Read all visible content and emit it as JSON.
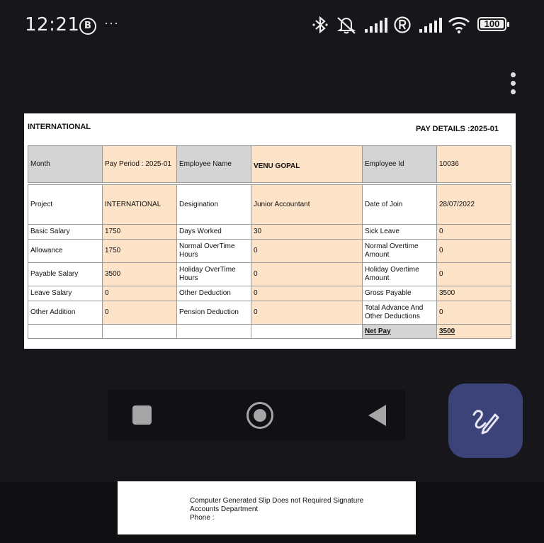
{
  "status": {
    "time": "12:21",
    "whatsapp_glyph": "B",
    "overflow": "···",
    "battery": "100"
  },
  "document": {
    "org": "INTERNATIONAL",
    "pay_details": "PAY DETAILS :2025-01",
    "header": {
      "month_label": "Month",
      "pay_period": "Pay Period : 2025-01",
      "employee_name_label": "Employee Name",
      "employee_name": "VENU GOPAL",
      "employee_id_label": "Employee Id",
      "employee_id": "10036"
    },
    "rows": [
      [
        "Project",
        "INTERNATIONAL",
        "Desigination",
        "Junior Accountant",
        "Date of Join",
        "28/07/2022"
      ],
      [
        "Basic Salary",
        "1750",
        "Days Worked",
        "30",
        "Sick Leave",
        "0"
      ],
      [
        "Allowance",
        "1750",
        "Normal OverTime Hours",
        "0",
        "Normal Overtime Amount",
        "0"
      ],
      [
        "Payable Salary",
        "3500",
        "Holiday OverTime Hours",
        "0",
        "Holiday Overtime Amount",
        "0"
      ],
      [
        "Leave Salary",
        "0",
        "Other Deduction",
        "0",
        "Gross Payable",
        "3500"
      ],
      [
        "Other Addition",
        "0",
        "Pension Deduction",
        "0",
        "Total Advance And Other Deductions",
        "0"
      ],
      [
        "",
        "",
        "",
        "",
        "Net Pay",
        "3500"
      ]
    ]
  },
  "footer": {
    "line1": "Computer Generated Slip Does not Required Signature",
    "line2": "Accounts Department",
    "line3": "Phone :"
  }
}
